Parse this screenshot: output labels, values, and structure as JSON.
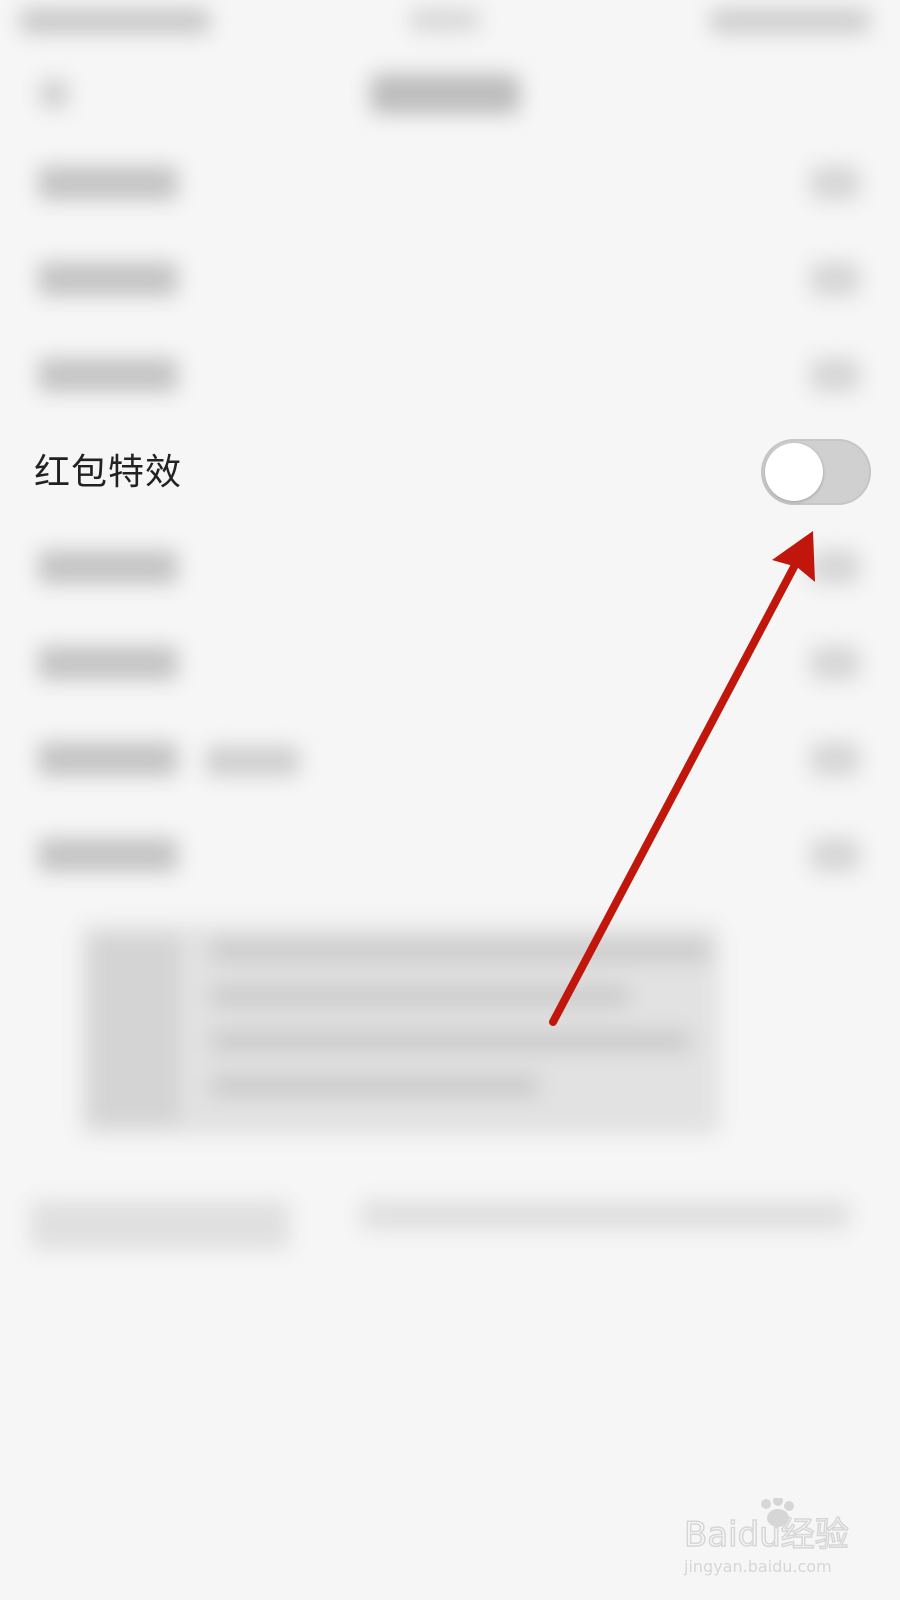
{
  "setting": {
    "label": "红包特效",
    "enabled": false
  },
  "colors": {
    "toggle_off_track": "#d0d0d0",
    "annotation_arrow": "#c0160c"
  },
  "watermark": {
    "logo_text": "Baidu经验",
    "url_text": "jingyan.baidu.com"
  }
}
